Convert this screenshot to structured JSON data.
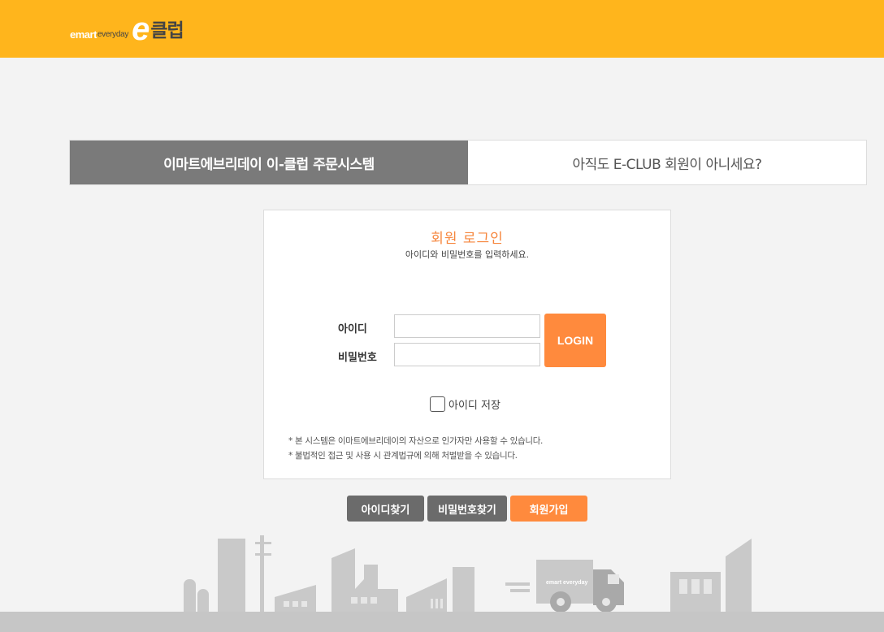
{
  "header": {
    "logo": {
      "emart": "emart",
      "everyday": "everyday",
      "e": "e",
      "club": "클럽"
    },
    "brand_color": "#ffb51c"
  },
  "tabs": [
    {
      "label": "이마트에브리데이 이-클럽 주문시스템",
      "active": true
    },
    {
      "label": "아직도 E-CLUB 회원이 아니세요?",
      "active": false
    }
  ],
  "login": {
    "title": "회원 로그인",
    "subtitle": "아이디와 비밀번호를 입력하세요.",
    "id_label": "아이디",
    "pw_label": "비밀번호",
    "id_value": "",
    "pw_value": "",
    "login_button": "LOGIN",
    "save_id_label": "아이디 저장",
    "save_id_checked": false,
    "notes": [
      "* 본 시스템은 이마트에브리데이의 자산으로 인가자만 사용할 수 있습니다.",
      "* 불법적인 접근 및 사용 시 관계법규에 의해 처벌받을 수 있습니다."
    ]
  },
  "actions": {
    "find_id": "아이디찾기",
    "find_pw": "비밀번호찾기",
    "join": "회원가입"
  },
  "illustration": {
    "truck_label": "emart everyday"
  },
  "colors": {
    "accent": "#ff8a3d",
    "tab_active": "#7a7a7a",
    "button_gray": "#6b6b6b"
  }
}
